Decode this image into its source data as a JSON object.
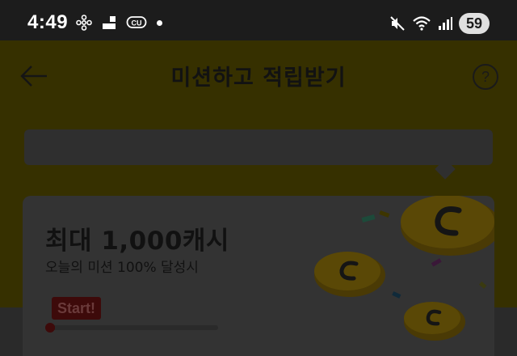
{
  "status_bar": {
    "time": "4:49",
    "left_icons": [
      "fan-icon",
      "app-tiles-icon",
      "cu-icon",
      "dot-icon"
    ],
    "right_icons": [
      "mute-icon",
      "wifi-icon",
      "signal-icon"
    ],
    "battery": "59"
  },
  "header": {
    "title": "미션하고 적립받기",
    "back_icon": "arrow-left-icon",
    "help_icon": "question-icon",
    "help_symbol": "?"
  },
  "mission_card": {
    "title": "최대 1,000캐시",
    "subtitle": "오늘의 미션 100% 달성시",
    "badge": "Start!",
    "progress": 0.02,
    "illustration": "coins-confetti"
  },
  "colors": {
    "status_bar_bg": "#1c1c1c",
    "header_bg_dimmed": "#363000",
    "card_bg_dimmed": "#333333",
    "badge_bg": "#3d0a0a"
  }
}
